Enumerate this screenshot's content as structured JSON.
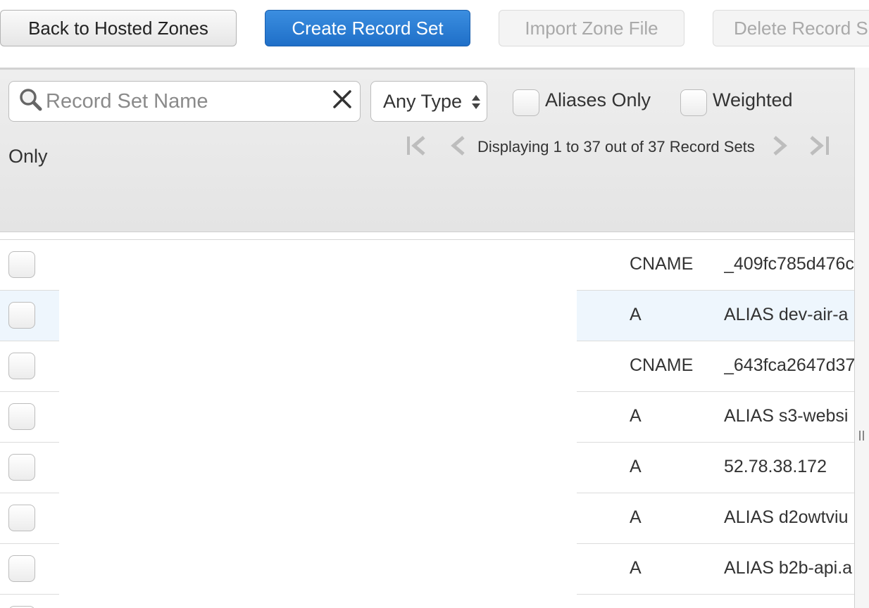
{
  "toolbar": {
    "back_label": "Back to Hosted Zones",
    "create_label": "Create Record Set",
    "import_label": "Import Zone File",
    "delete_label": "Delete Record S"
  },
  "filters": {
    "search_placeholder": "Record Set Name",
    "type_select": "Any Type",
    "aliases_only": "Aliases Only",
    "weighted": "Weighted",
    "weighted_wrap": "Only"
  },
  "pager": {
    "text": "Displaying 1 to 37 out of 37 Record Sets"
  },
  "rows": [
    {
      "type": "CNAME",
      "value": "_409fc785d476c"
    },
    {
      "type": "A",
      "value": "ALIAS dev-air-a"
    },
    {
      "type": "CNAME",
      "value": "_643fca2647d37"
    },
    {
      "type": "A",
      "value": "ALIAS s3-websi"
    },
    {
      "type": "A",
      "value": "52.78.38.172"
    },
    {
      "type": "A",
      "value": "ALIAS d2owtviu"
    },
    {
      "type": "A",
      "value": "ALIAS b2b-api.a"
    }
  ],
  "colors": {
    "primary_button": "#1f6fc8",
    "row_highlight": "#eef6fd",
    "panel_bg": "#e8e8e8"
  }
}
